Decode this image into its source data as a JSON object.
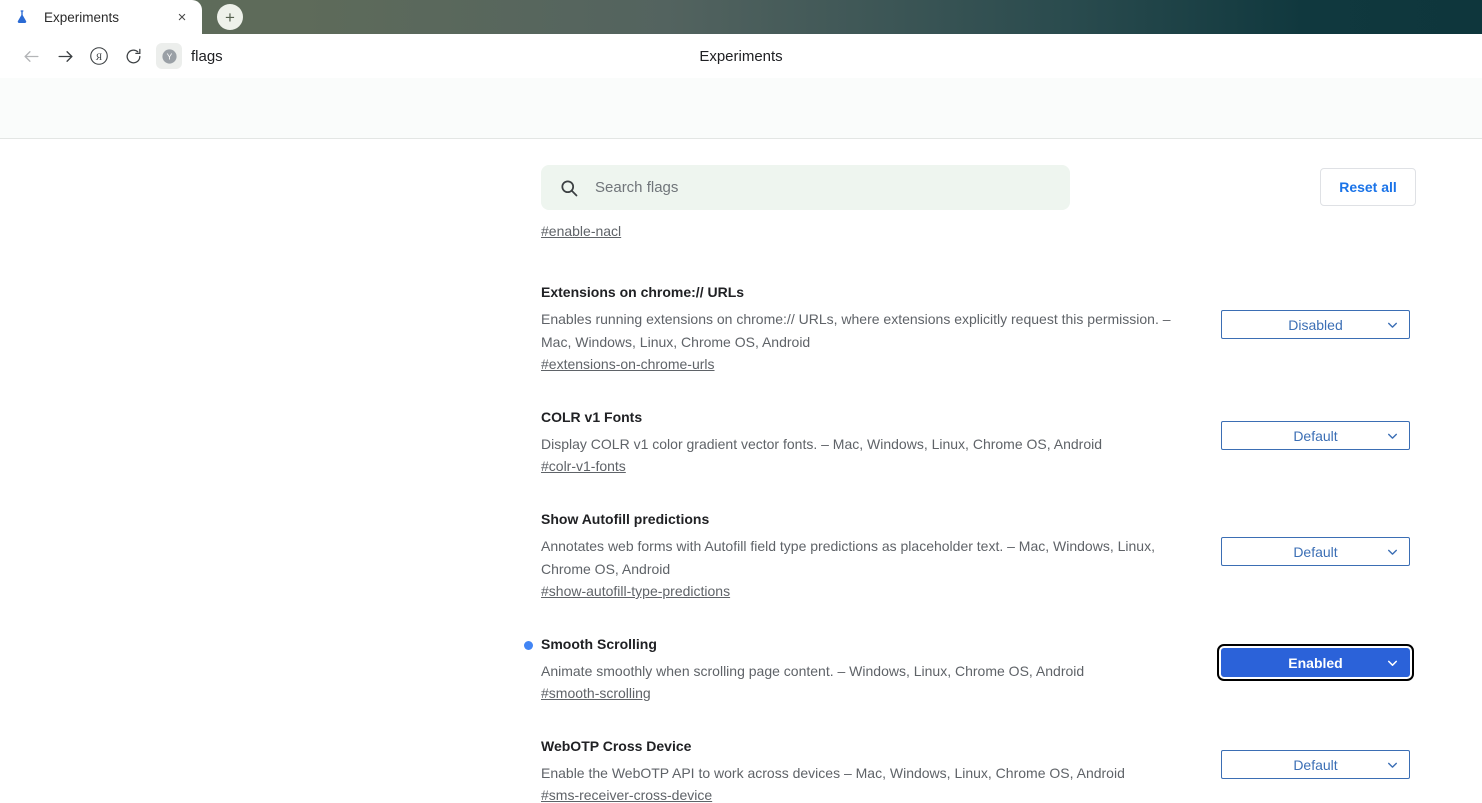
{
  "browser": {
    "tab": {
      "favicon": "flask-icon",
      "title": "Experiments",
      "close_label": "×"
    },
    "new_tab_label": "+",
    "toolbar": {
      "back_label": "←",
      "forward_label": "→",
      "yandex_label": "Я",
      "reload_label": "↻",
      "site_badge_label": "Y",
      "omnibox_value": "flags",
      "page_title": "Experiments"
    }
  },
  "flags_page": {
    "search": {
      "placeholder": "Search flags",
      "value": ""
    },
    "reset_all_label": "Reset all",
    "orphan_permalink": "#enable-nacl",
    "colors": {
      "accent_blue": "#2b62d9",
      "link_blue": "#1a73e8",
      "select_border": "#3b6eb4",
      "dot_blue": "#4285f4",
      "search_bg": "#eef5ef"
    },
    "entries": [
      {
        "title": "Extensions on chrome:// URLs",
        "description": "Enables running extensions on chrome:// URLs, where extensions explicitly request this permission. – Mac, Windows, Linux, Chrome OS, Android",
        "permalink": "#extensions-on-chrome-urls",
        "value": "Disabled",
        "modified": false,
        "focused": false
      },
      {
        "title": "COLR v1 Fonts",
        "description": "Display COLR v1 color gradient vector fonts. – Mac, Windows, Linux, Chrome OS, Android",
        "permalink": "#colr-v1-fonts",
        "value": "Default",
        "modified": false,
        "focused": false
      },
      {
        "title": "Show Autofill predictions",
        "description": "Annotates web forms with Autofill field type predictions as placeholder text. – Mac, Windows, Linux, Chrome OS, Android",
        "permalink": "#show-autofill-type-predictions",
        "value": "Default",
        "modified": false,
        "focused": false
      },
      {
        "title": "Smooth Scrolling",
        "description": "Animate smoothly when scrolling page content. – Windows, Linux, Chrome OS, Android",
        "permalink": "#smooth-scrolling",
        "value": "Enabled",
        "modified": true,
        "focused": true
      },
      {
        "title": "WebOTP Cross Device",
        "description": "Enable the WebOTP API to work across devices – Mac, Windows, Linux, Chrome OS, Android",
        "permalink": "#sms-receiver-cross-device",
        "value": "Default",
        "modified": false,
        "focused": false
      }
    ],
    "select_options": [
      "Default",
      "Enabled",
      "Disabled"
    ]
  }
}
